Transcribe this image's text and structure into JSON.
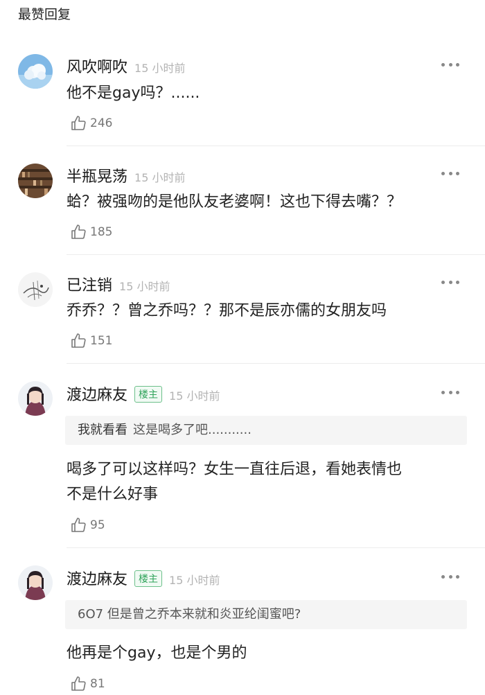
{
  "section_title": "最赞回复",
  "comments": [
    {
      "username": "风吹啊吹",
      "time": "15 小时前",
      "content": "他不是gay吗？......",
      "likes": "246",
      "avatar": "sky-clouds-avatar"
    },
    {
      "username": "半瓶晃荡",
      "time": "15 小时前",
      "content": "蛤？被强吻的是他队友老婆啊！这也下得去嘴？？",
      "likes": "185",
      "avatar": "bookshelf-avatar"
    },
    {
      "username": "已注销",
      "time": "15 小时前",
      "content": "乔乔？？曾之乔吗？？那不是辰亦儒的女朋友吗",
      "likes": "151",
      "avatar": "sketch-avatar"
    },
    {
      "username": "渡边麻友",
      "badge": "楼主",
      "time": "15 小时前",
      "quote_user": "我就看看",
      "quote_text": "这是喝多了吧...........",
      "content_lines": [
        "喝多了可以这样吗？女生一直往后退，看她表情也",
        "不是什么好事"
      ],
      "likes": "95",
      "avatar": "girl-portrait-avatar"
    },
    {
      "username": "渡边麻友",
      "badge": "楼主",
      "time": "15 小时前",
      "quote_user": "",
      "quote_text": "6O7 但是曾之乔本来就和炎亚纶闺蜜吧?",
      "content": "他再是个gay，也是个男的",
      "likes": "81",
      "avatar": "girl-portrait-avatar"
    }
  ],
  "colors": {
    "badge_green": "#2fa35a",
    "time_gray": "#b3b3b3",
    "quote_bg": "#f5f5f5"
  }
}
